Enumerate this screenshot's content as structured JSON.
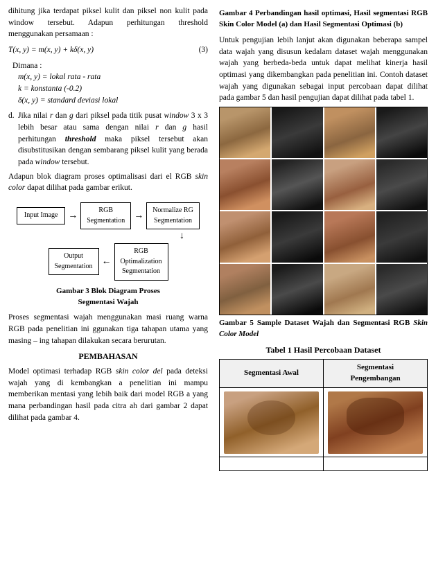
{
  "left_col": {
    "intro_text": "dihitung jika terdapat piksel kulit dan piksel non kulit pada window tersebut. Adapun perhitungan threshold menggunakan persamaan :",
    "formula": "T(x, y) = m(x, y) + kδ(x, y)",
    "formula_eq_num": "(3)",
    "dimana_label": "Dimana :",
    "var1": "m(x, y) = lokal rata - rata",
    "var2": "k = konstanta (-0.2)",
    "var3": "δ(x, y) = standard deviasi lokal",
    "item_d_text": "Jika nilai r dan g dari piksel pada titik pusat window 3 x 3 lebih besar atau sama dengan nilai r dan g hasil perhitungan threshold maka piksel tersebut akan disubstitusikan dengan sembarang piksel kulit yang berada pada window tersebut.",
    "adapun_text": "Adapun blok diagram proses optimalisasi dari el RGB skin color dapat dilihat pada gambar erikut.",
    "flow_boxes": {
      "input": "Input Image",
      "rgb_seg": "RGB\nSegmentation",
      "norm_rg": "Normalize RG\nSegmentation",
      "rgb_opt": "RGB\nOptimalization\nSegmentation",
      "output": "Output\nSegmentation"
    },
    "fig3_caption": "Gambar 3 Blok Diagram Proses\nSegmentasi Wajah",
    "proses_text": "Proses segmentasi wajah menggunakan masi ruang warna RGB pada penelitian ini ggunakan tiga tahapan utama yang masing – ing tahapan dilakukan secara berurutan.",
    "pembahasan_heading": "PEMBAHASAN",
    "pembahasan_text": "Model optimasi terhadap RGB skin color del pada deteksi wajah yang di kembangkan a penelitian ini mampu memberikan mentasi yang lebih baik dari model RGB a yang mana perbandingan hasil pada citra ah dari gambar 2 dapat dilihat pada gambar 4."
  },
  "right_col": {
    "fig4_caption_bold": "Gambar 4 Perbandingan hasil optimasi, Hasil segmentasi RGB Skin Color Model (a) dan Hasil Segmentasi Optimasi (b)",
    "intro_text": "Untuk pengujian lebih lanjut akan digunakan beberapa sampel data wajah yang disusun kedalam dataset wajah menggunakan wajah yang berbeda-beda untuk dapat melihat kinerja hasil optimasi yang dikembangkan pada penelitian ini. Contoh dataset wajah yang digunakan sebagai input percobaan dapat dilihat pada gambar 5 dan hasil pengujian dapat dilihat pada tabel 1.",
    "fig5_caption_bold": "Gambar 5 Sample Dataset Wajah dan Segmentasi RGB Skin Color Model",
    "table1_title": "Tabel 1 Hasil Percobaan Dataset",
    "table_header1": "Segmentasi Awal",
    "table_header2": "Segmentasi\nPengembangan",
    "face_rows": [
      {
        "row": 0
      },
      {
        "row": 1
      },
      {
        "row": 2
      },
      {
        "row": 3
      }
    ]
  }
}
